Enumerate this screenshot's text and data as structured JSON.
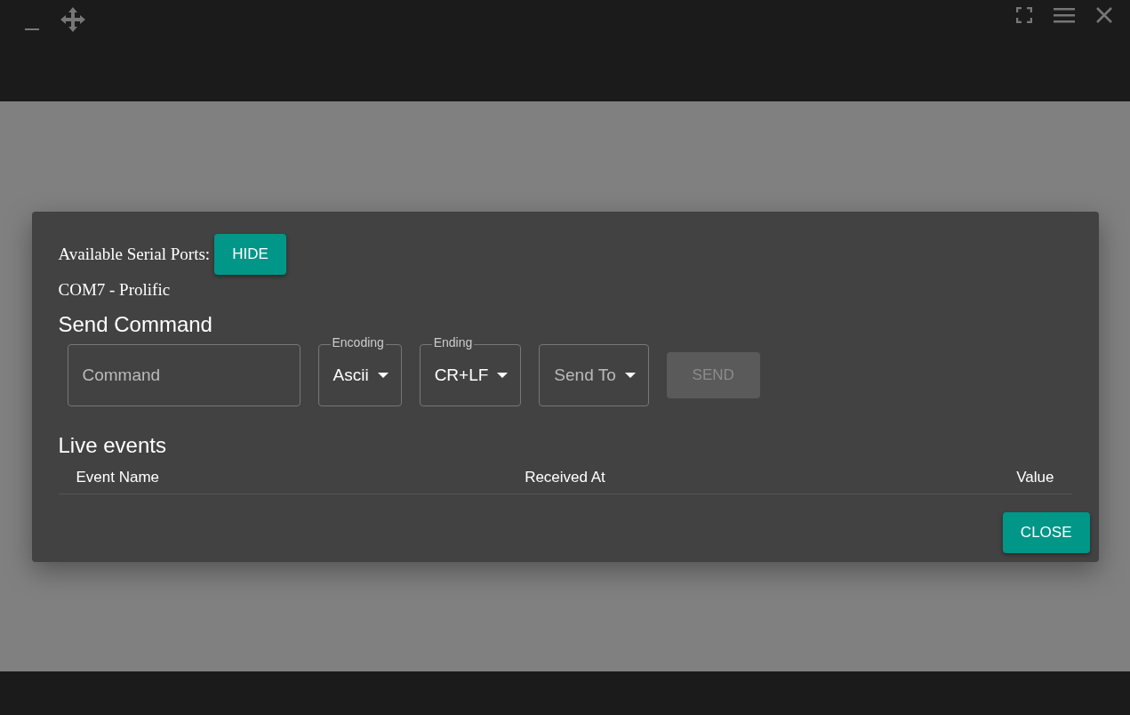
{
  "serial_ports": {
    "label": "Available Serial Ports:",
    "toggle_button": "HIDE",
    "ports": [
      "COM7 - Prolific"
    ]
  },
  "send_command": {
    "title": "Send Command",
    "command": {
      "placeholder": "Command"
    },
    "selects": [
      {
        "label": "Encoding",
        "value": "Ascii"
      },
      {
        "label": "Ending",
        "value": "CR+LF"
      },
      {
        "placeholder": "Send To"
      }
    ],
    "send_button": {
      "label": "SEND",
      "disabled": true
    }
  },
  "live_events": {
    "title": "Live events",
    "columns": [
      "Event Name",
      "Received At",
      "Value"
    ]
  },
  "close_button": "CLOSE"
}
